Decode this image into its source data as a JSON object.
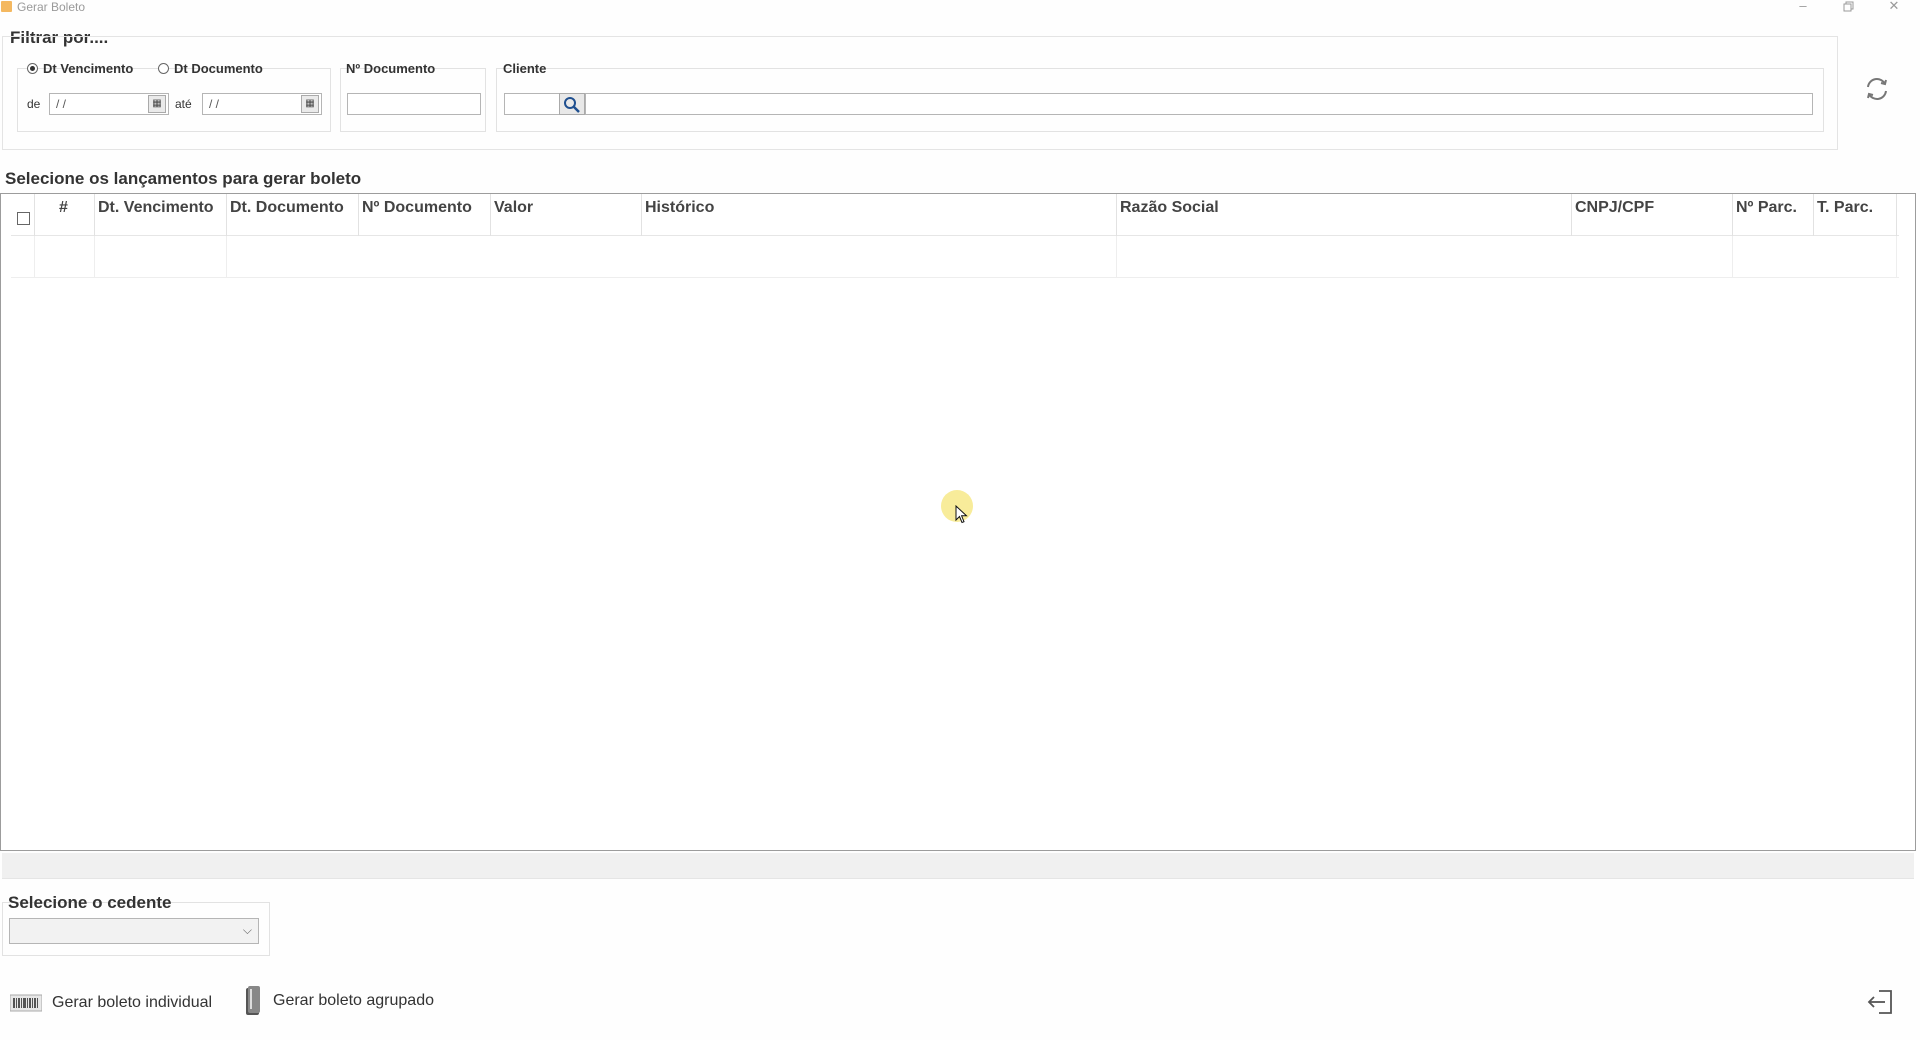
{
  "window": {
    "title": "Gerar Boleto",
    "minimize_icon": "minimize-icon",
    "restore_icon": "restore-icon",
    "close_icon": "close-icon"
  },
  "filter": {
    "heading": "Filtrar por....",
    "radio_vencimento": "Dt Vencimento",
    "radio_documento": "Dt Documento",
    "selected_radio": "Dt Vencimento",
    "de_label": "de",
    "ate_label": "até",
    "de_value": "/ /",
    "ate_value": "/ /",
    "doc_label": "Nº Documento",
    "doc_value": "",
    "cliente_label": "Cliente",
    "cliente_code": "",
    "cliente_name": ""
  },
  "grid": {
    "heading": "Selecione os lançamentos para gerar boleto",
    "columns": [
      "#",
      "Dt. Vencimento",
      "Dt. Documento",
      "Nº Documento",
      "Valor",
      "Histórico",
      "Razão Social",
      "CNPJ/CPF",
      "Nº Parc.",
      "T. Parc."
    ],
    "rows": []
  },
  "cedente": {
    "heading": "Selecione o cedente",
    "selected": ""
  },
  "actions": {
    "gerar_individual": "Gerar boleto individual",
    "gerar_agrupado": "Gerar boleto agrupado"
  },
  "icons": {
    "refresh": "refresh-icon",
    "exit": "exit-icon",
    "calendar": "calendar-icon",
    "search": "search-icon",
    "barcode": "barcode-icon",
    "boleto": "boleto-icon"
  }
}
